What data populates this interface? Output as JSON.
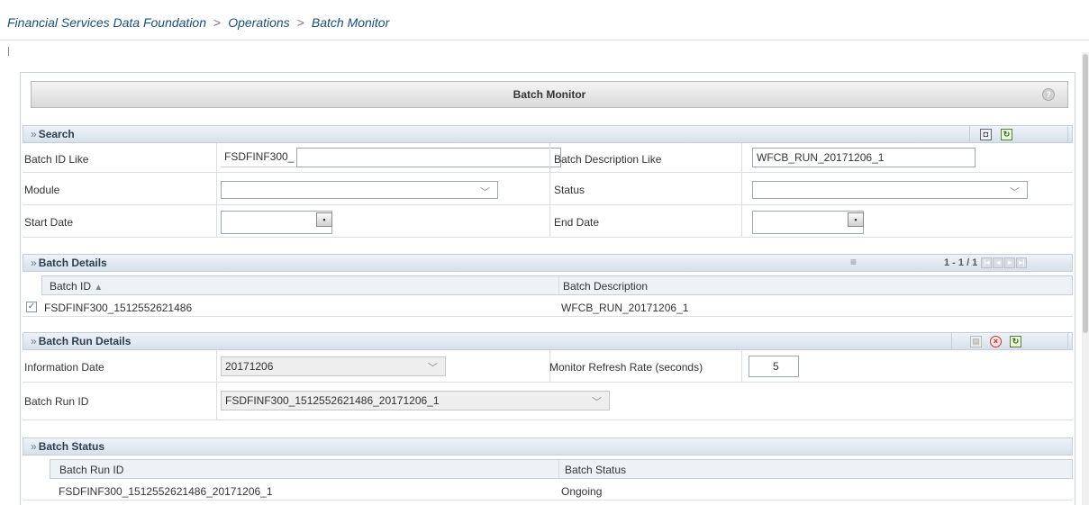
{
  "breadcrumb": {
    "items": [
      "Financial Services Data Foundation",
      "Operations",
      "Batch Monitor"
    ],
    "separator": ">"
  },
  "title": "Batch Monitor",
  "icons": {
    "help": "help-icon",
    "search_view": "view-icon",
    "export": "export-icon",
    "stop": "stop-icon",
    "filter": "filter-icon"
  },
  "search": {
    "header": "Search",
    "batch_id_label": "Batch ID Like",
    "batch_id_value": "FSDFINF300_",
    "batch_desc_label": "Batch Description Like",
    "batch_desc_value": "WFCB_RUN_20171206_1",
    "module_label": "Module",
    "module_value": "",
    "status_label": "Status",
    "status_value": "",
    "start_date_label": "Start Date",
    "start_date_value": "",
    "end_date_label": "End Date",
    "end_date_value": ""
  },
  "batch_details": {
    "header": "Batch Details",
    "pager": "1 - 1 / 1",
    "columns": [
      "Batch ID",
      "Batch Description"
    ],
    "sort_indicator": "▲",
    "rows": [
      {
        "batch_id": "FSDFINF300_1512552621486",
        "description": "WFCB_RUN_20171206_1",
        "checked": true
      }
    ]
  },
  "batch_run_details": {
    "header": "Batch Run Details",
    "info_date_label": "Information Date",
    "info_date_value": "20171206",
    "refresh_label": "Monitor Refresh Rate (seconds)",
    "refresh_value": "5",
    "run_id_label": "Batch Run ID",
    "run_id_value": "FSDFINF300_1512552621486_20171206_1"
  },
  "batch_status": {
    "header": "Batch Status",
    "columns": [
      "Batch Run ID",
      "Batch Status"
    ],
    "rows": [
      {
        "run_id": "FSDFINF300_1512552621486_20171206_1",
        "status": "Ongoing"
      }
    ]
  },
  "colors": {
    "breadcrumb": "#1a4e7a",
    "header_bg": "#d7e1ea",
    "border": "#c3ced9"
  }
}
